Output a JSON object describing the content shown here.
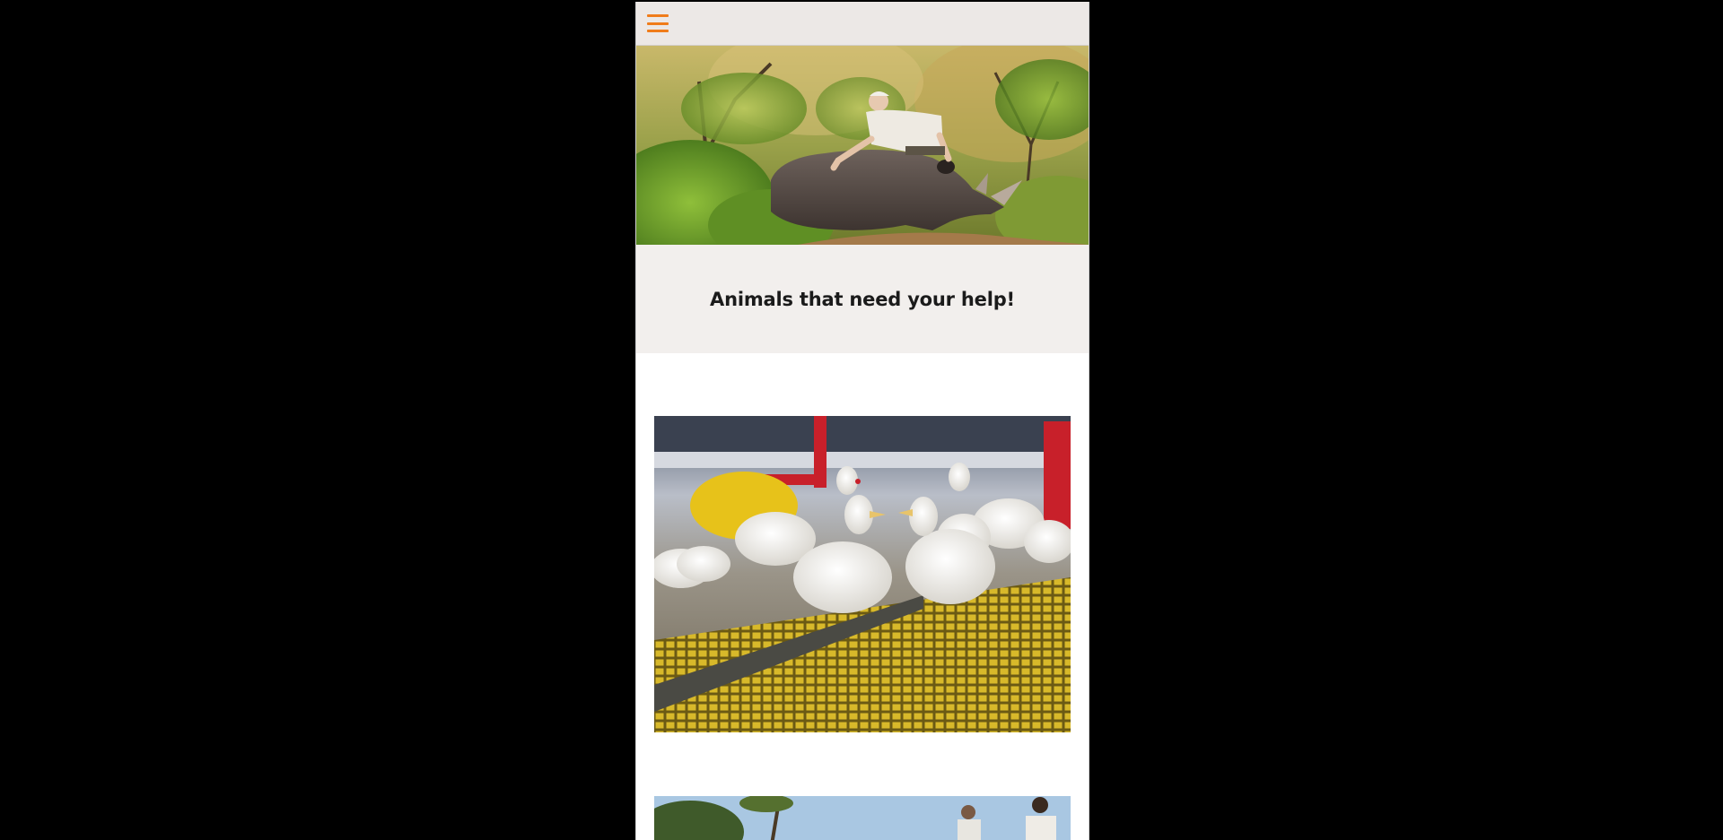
{
  "app": {
    "accent_color": "#f07c1a",
    "header_background": "#ece8e6"
  },
  "header": {
    "menu_icon": "hamburger-menu-icon"
  },
  "hero": {
    "image_subject": "man-kneeling-beside-rhinoceros-in-bush"
  },
  "section": {
    "title": "Animals that need your help!"
  },
  "cards": [
    {
      "image_subject": "chickens-on-yellow-slatted-farm-floor"
    },
    {
      "image_subject": "people-under-blue-sky-with-trees"
    }
  ]
}
